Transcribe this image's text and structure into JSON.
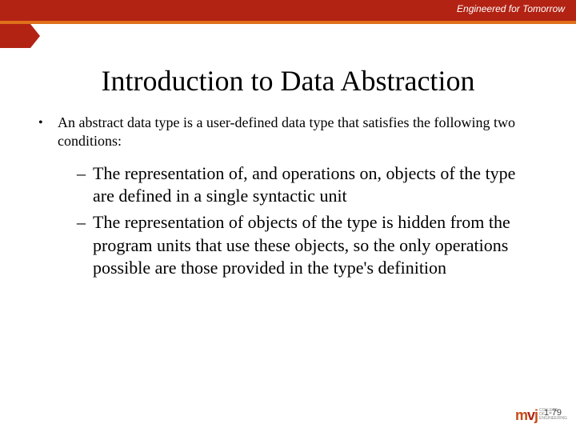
{
  "header": {
    "tagline": "Engineered for Tomorrow"
  },
  "slide": {
    "title": "Introduction to Data Abstraction",
    "intro": "An abstract data type is a user-defined data type that satisfies the following two conditions:",
    "points": [
      "The representation of, and operations on, objects of the type are defined in a single syntactic unit",
      "The representation of objects of the type is hidden from the program units that use these objects, so the only operations possible are those provided in the type's definition"
    ]
  },
  "footer": {
    "page_number": "1-79",
    "logo_text": "mvj",
    "logo_sub": "COLLEGE OF ENGINEERING"
  }
}
